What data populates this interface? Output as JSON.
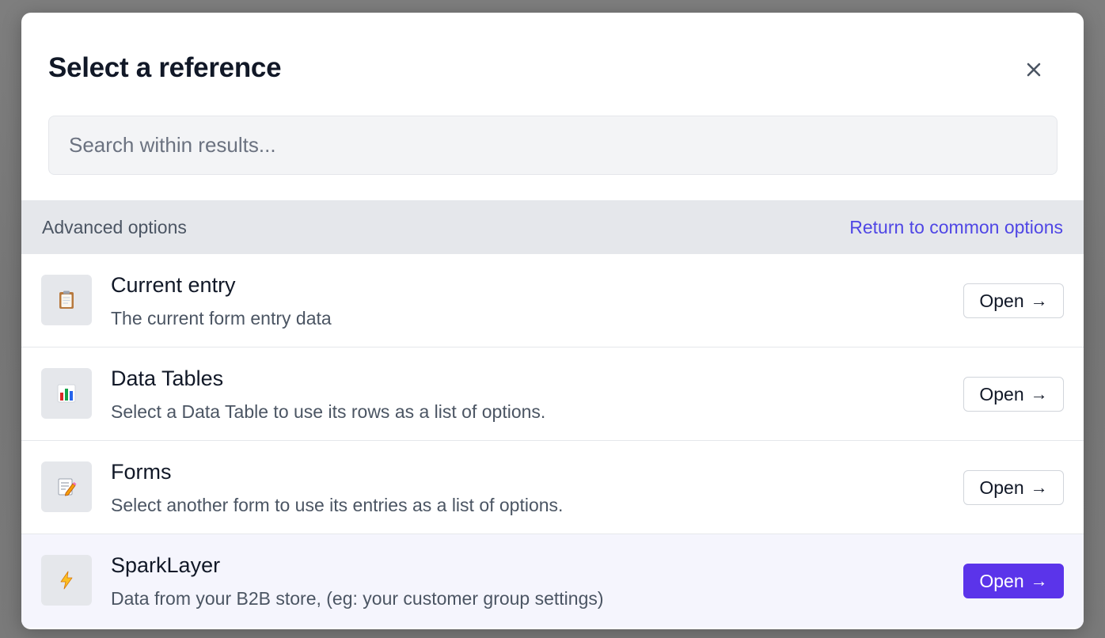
{
  "modal": {
    "title": "Select a reference",
    "close_icon": "close-icon"
  },
  "search": {
    "placeholder": "Search within results...",
    "value": ""
  },
  "section": {
    "title": "Advanced options",
    "return_link": "Return to common options"
  },
  "options": [
    {
      "icon": "clipboard-icon",
      "title": "Current entry",
      "description": "The current form entry data",
      "button_label": "Open",
      "arrow": "→"
    },
    {
      "icon": "bar-chart-icon",
      "title": "Data Tables",
      "description": "Select a Data Table to use its rows as a list of options.",
      "button_label": "Open",
      "arrow": "→"
    },
    {
      "icon": "memo-icon",
      "title": "Forms",
      "description": "Select another form to use its entries as a list of options.",
      "button_label": "Open",
      "arrow": "→"
    },
    {
      "icon": "lightning-icon",
      "title": "SparkLayer",
      "description": "Data from your B2B store, (eg: your customer group settings)",
      "button_label": "Open",
      "arrow": "→"
    }
  ],
  "colors": {
    "accent": "#5b34ea",
    "link": "#4f46e5",
    "section_bg": "#e5e7eb",
    "highlight_row": "#f5f5fd"
  }
}
